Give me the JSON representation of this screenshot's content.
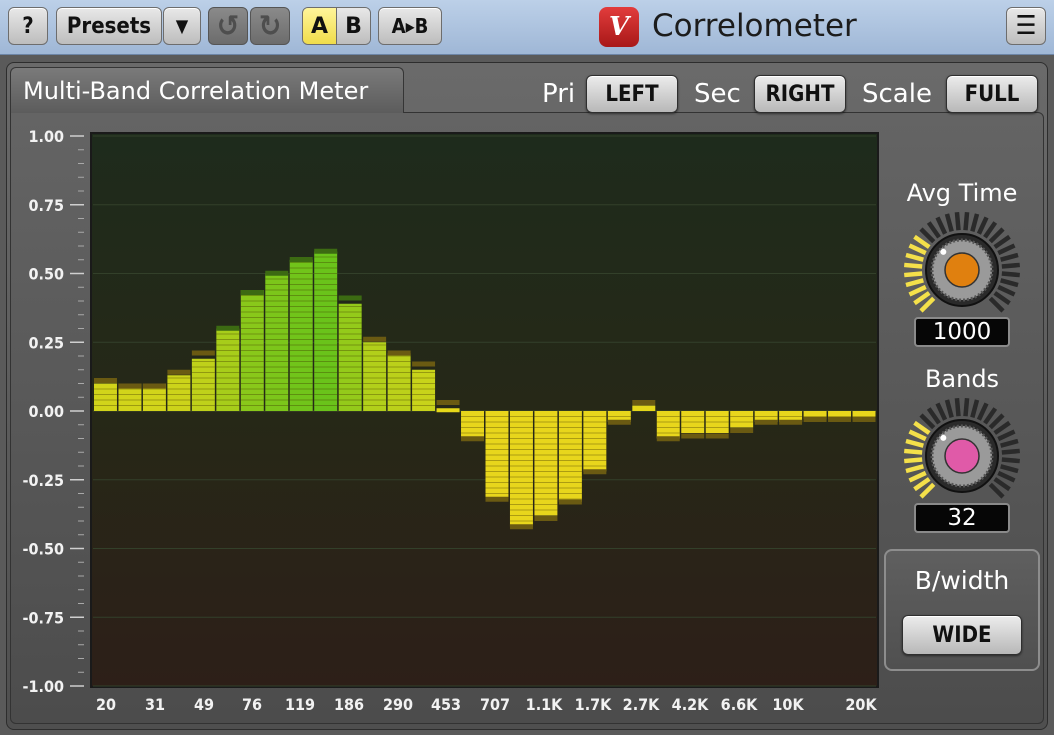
{
  "toolbar": {
    "help_label": "?",
    "presets_label": "Presets",
    "dropdown_glyph": "▼",
    "undo_glyph": "↺",
    "redo_glyph": "↻",
    "a_label": "A",
    "b_label": "B",
    "a_to_b_label": "A▸B",
    "menu_glyph": "☰"
  },
  "app": {
    "logo_text": "V",
    "title": "Correlometer"
  },
  "panel": {
    "title": "Multi-Band Correlation Meter",
    "pri_label": "Pri",
    "pri_value": "LEFT",
    "sec_label": "Sec",
    "sec_value": "RIGHT",
    "scale_label": "Scale",
    "scale_value": "FULL"
  },
  "controls": {
    "avg_time_label": "Avg Time",
    "avg_time_value": "1000",
    "avg_time_level": 0.33,
    "bands_label": "Bands",
    "bands_value": "32",
    "bands_level": 0.33,
    "bwidth_label": "B/width",
    "bwidth_value": "WIDE"
  },
  "colors": {
    "accent_yellow": "#f2e24a",
    "avg_knob_cap": "#e0800f",
    "bands_knob_cap": "#e05aa8",
    "bar_green": "#6cc21a",
    "bar_yellow": "#e8d81a"
  },
  "chart_data": {
    "type": "bar",
    "ylim": [
      -1.0,
      1.0
    ],
    "y_ticks": [
      "1.00",
      "0.75",
      "0.50",
      "0.25",
      "0.00",
      "-0.25",
      "-0.50",
      "-0.75",
      "-1.00"
    ],
    "x_ticks": [
      "20",
      "31",
      "49",
      "76",
      "119",
      "186",
      "290",
      "453",
      "707",
      "1.1K",
      "1.7K",
      "2.7K",
      "4.2K",
      "6.6K",
      "10K",
      "20K"
    ],
    "grid": true,
    "series": [
      {
        "values": [
          0.1,
          0.1,
          0.1,
          0.13,
          0.19,
          0.3,
          0.44,
          0.5,
          0.55,
          0.58,
          0.39,
          0.25,
          0.21,
          0.15,
          0.01,
          -0.1,
          -0.32,
          -0.42,
          -0.38,
          -0.33,
          -0.22,
          -0.04,
          0.02,
          -0.1,
          -0.08,
          -0.08,
          -0.06,
          -0.04,
          -0.04,
          -0.03,
          -0.03,
          -0.03
        ],
        "peaks": [
          0.12,
          0.1,
          0.1,
          0.15,
          0.22,
          0.31,
          0.44,
          0.51,
          0.56,
          0.59,
          0.42,
          0.27,
          0.22,
          0.18,
          0.04,
          -0.11,
          -0.33,
          -0.43,
          -0.4,
          -0.34,
          -0.23,
          -0.05,
          0.04,
          -0.11,
          -0.1,
          -0.1,
          -0.08,
          -0.05,
          -0.05,
          -0.04,
          -0.04,
          -0.04
        ]
      }
    ]
  }
}
